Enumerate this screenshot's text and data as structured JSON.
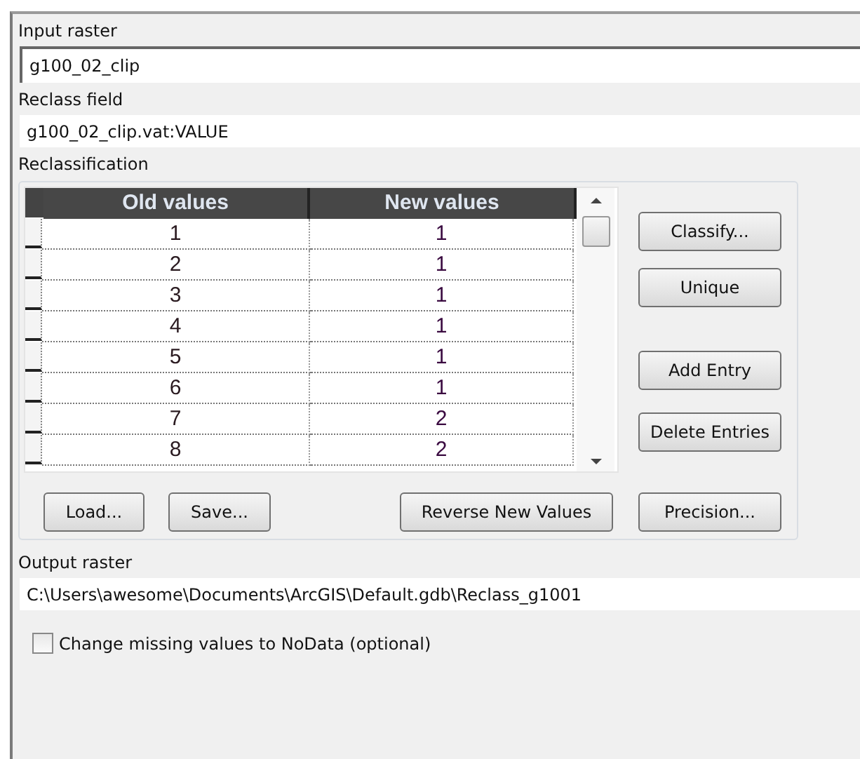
{
  "input_raster": {
    "label": "Input raster",
    "value": "g100_02_clip"
  },
  "reclass_field": {
    "label": "Reclass field",
    "value": "g100_02_clip.vat:VALUE"
  },
  "reclassification": {
    "label": "Reclassification",
    "columns": [
      "Old values",
      "New values"
    ],
    "rows": [
      {
        "old": "1",
        "new": "1"
      },
      {
        "old": "2",
        "new": "1"
      },
      {
        "old": "3",
        "new": "1"
      },
      {
        "old": "4",
        "new": "1"
      },
      {
        "old": "5",
        "new": "1"
      },
      {
        "old": "6",
        "new": "1"
      },
      {
        "old": "7",
        "new": "2"
      },
      {
        "old": "8",
        "new": "2"
      }
    ],
    "side_buttons": [
      "Classify...",
      "Unique",
      "Add Entry",
      "Delete Entries"
    ],
    "bottom_buttons": [
      "Load...",
      "Save...",
      "Reverse New Values",
      "Precision..."
    ]
  },
  "output_raster": {
    "label": "Output raster",
    "value": "C:\\Users\\awesome\\Documents\\ArcGIS\\Default.gdb\\Reclass_g1001"
  },
  "change_missing": {
    "label": "Change missing values to NoData (optional)",
    "checked": false
  }
}
